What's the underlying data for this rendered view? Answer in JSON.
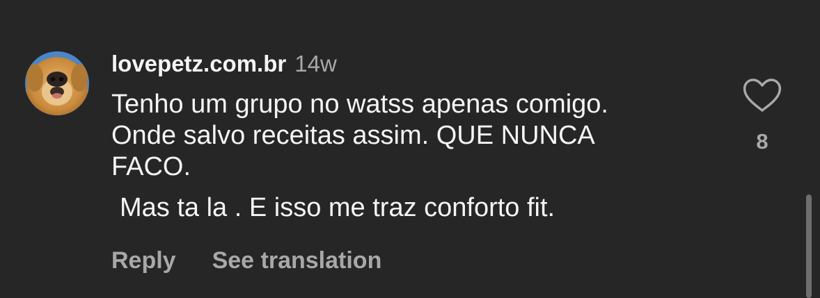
{
  "comment": {
    "username": "lovepetz.com.br",
    "timestamp": "14w",
    "lines": [
      "Tenho um grupo no watss apenas comigo.",
      "Onde salvo receitas assim. QUE NUNCA",
      "FACO."
    ],
    "second_paragraph": "Mas ta la . E isso me traz conforto fit.",
    "actions": {
      "reply_label": "Reply",
      "translate_label": "See translation"
    },
    "like_count": "8",
    "avatar_icon": "dog-photo-avatar",
    "like_icon": "heart-outline-icon"
  },
  "colors": {
    "background": "#262626",
    "primary_text": "#f5f5f5",
    "secondary_text": "#a8a8a8"
  }
}
